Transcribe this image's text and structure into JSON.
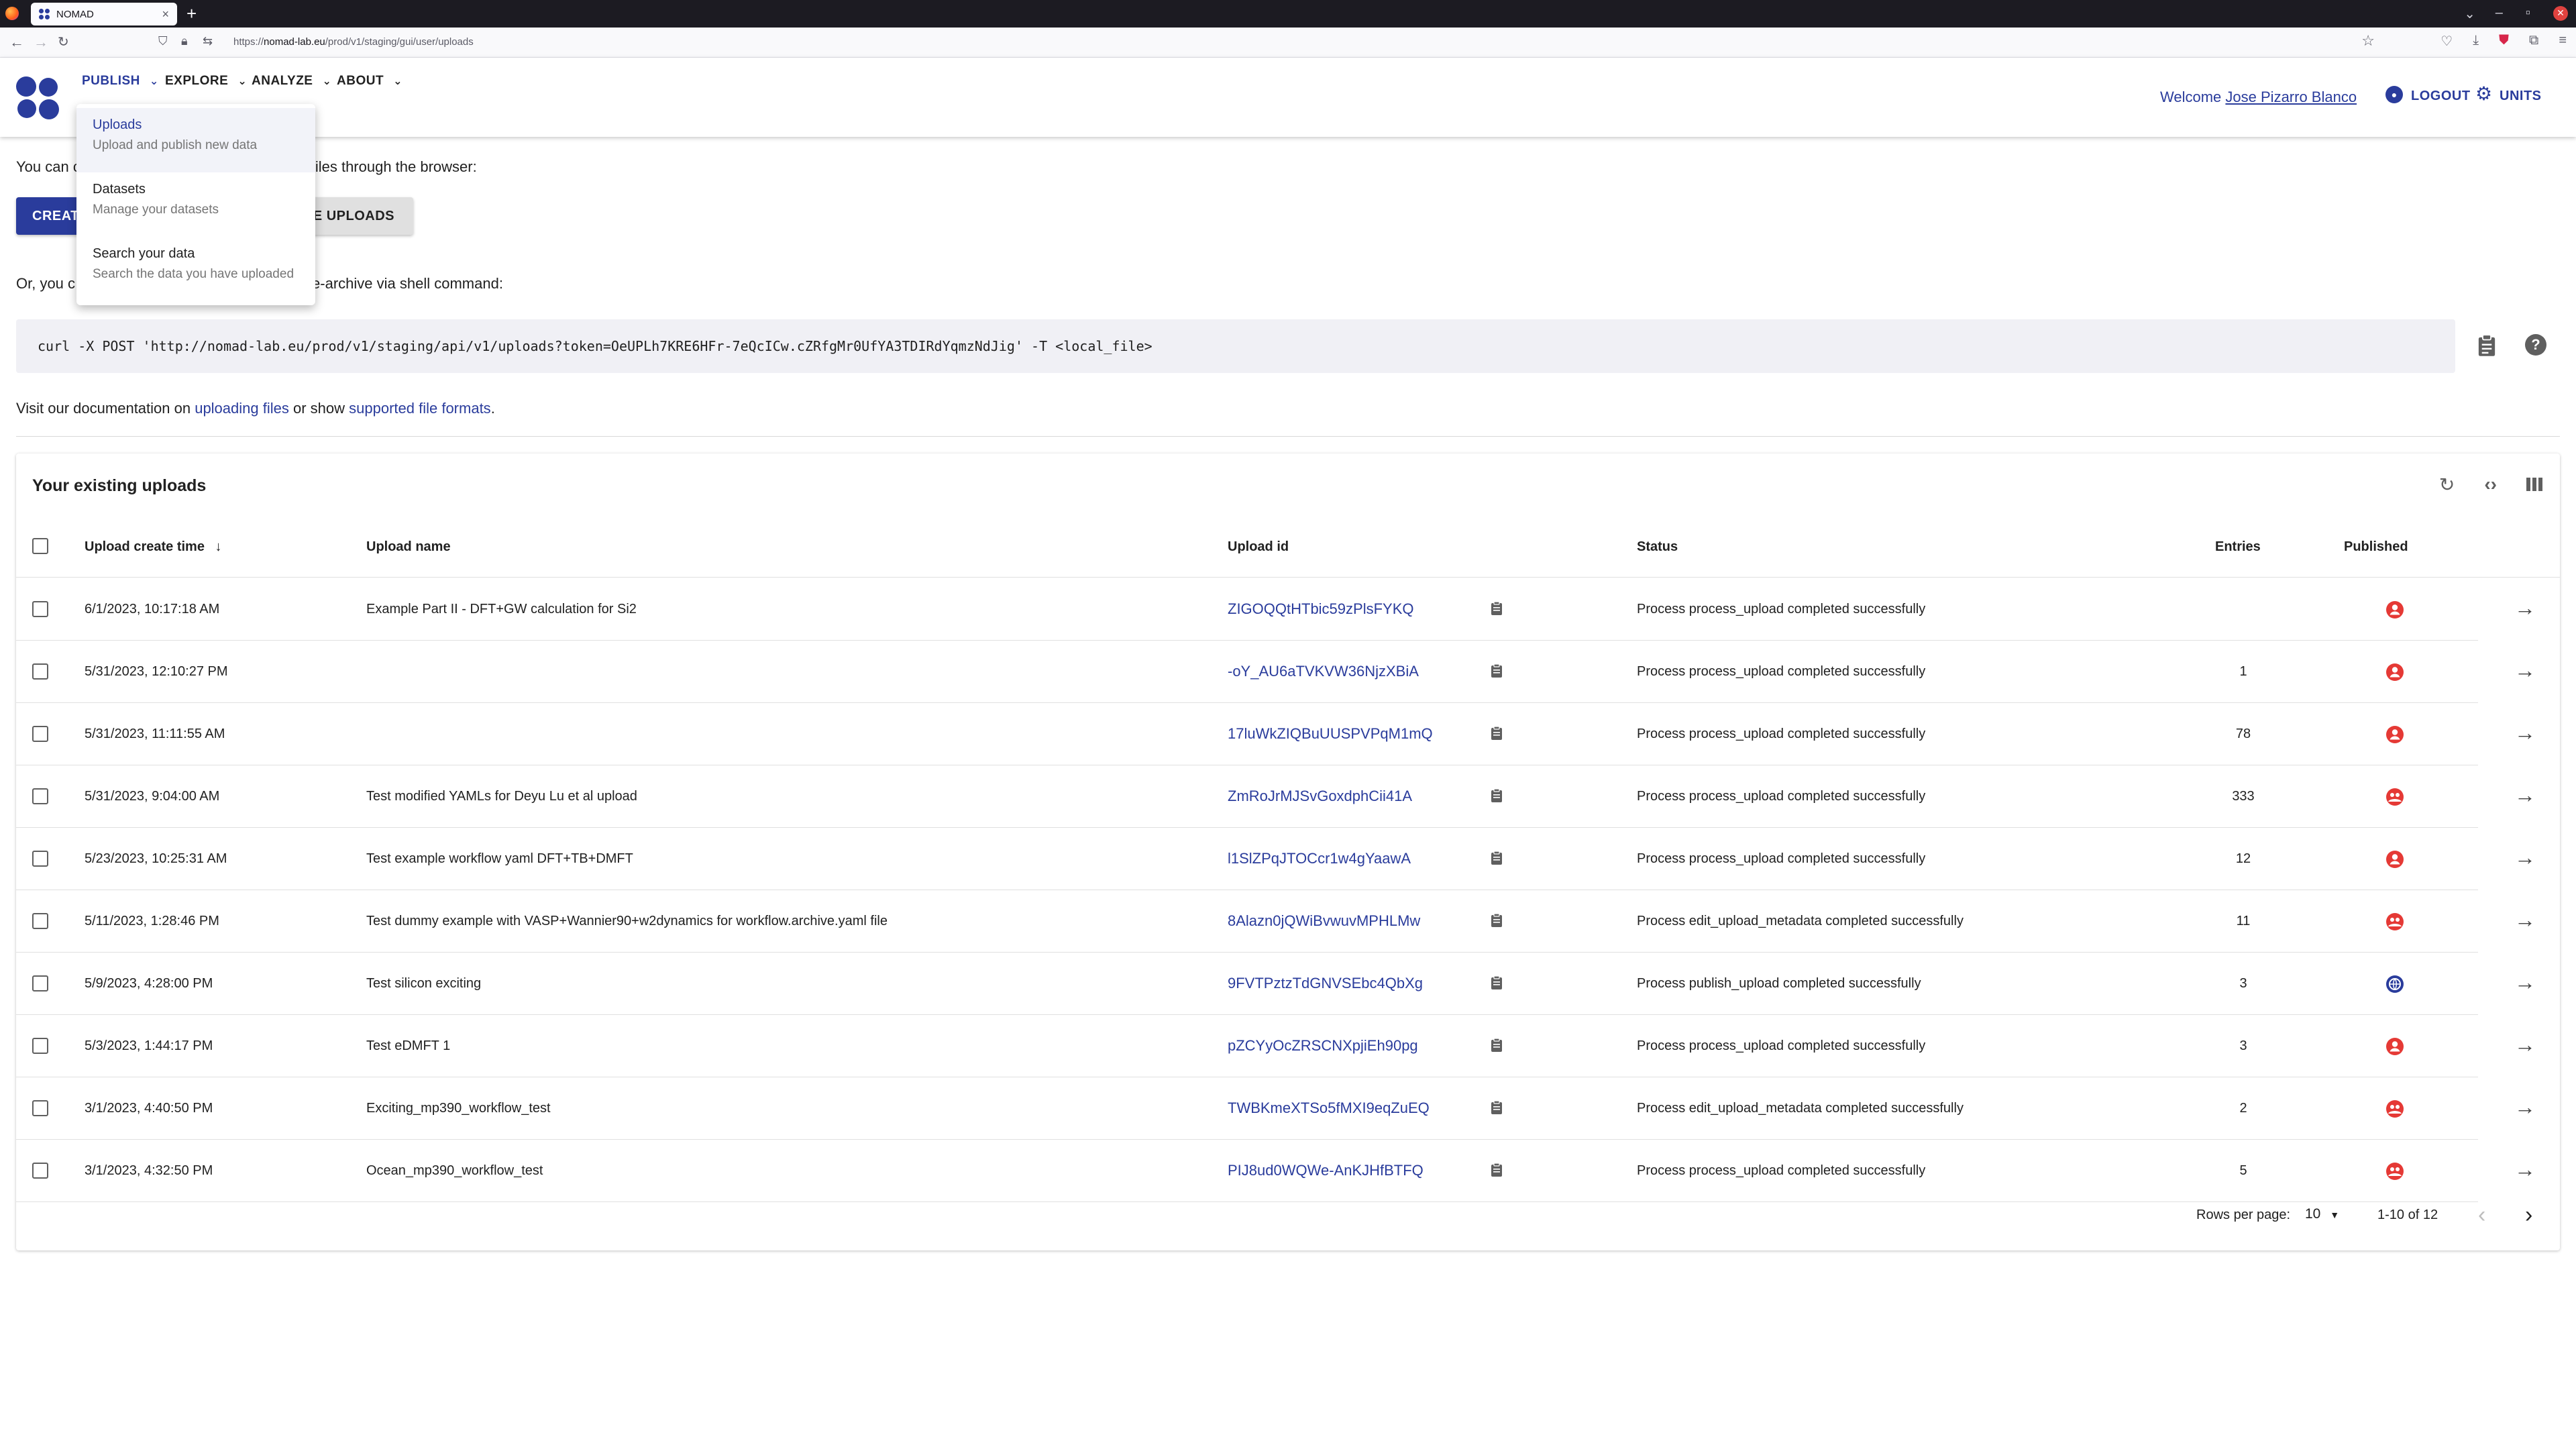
{
  "browser": {
    "tab_title": "NOMAD",
    "url_host": "nomad-lab.eu",
    "url_path": "/prod/v1/staging/gui/user/uploads",
    "url_prefix": "https://"
  },
  "appbar": {
    "menu": [
      {
        "label": "PUBLISH"
      },
      {
        "label": "EXPLORE"
      },
      {
        "label": "ANALYZE"
      },
      {
        "label": "ABOUT"
      }
    ],
    "welcome_prefix": "Welcome",
    "user_name": "Jose Pizarro Blanco",
    "logout_label": "LOGOUT",
    "units_label": "UNITS"
  },
  "dropdown": {
    "items": [
      {
        "title": "Uploads",
        "desc": "Upload and publish new data"
      },
      {
        "title": "Datasets",
        "desc": "Manage your datasets"
      },
      {
        "title": "Search your data",
        "desc": "Search the data you have uploaded"
      }
    ]
  },
  "content": {
    "intro_start": "You can c",
    "intro_end": "iles through the browser:",
    "create_label": "CREATE",
    "example_label": "PLE UPLOADS",
    "or_start": "Or, you c",
    "or_end": "e-archive via shell command:",
    "command": "curl -X POST 'http://nomad-lab.eu/prod/v1/staging/api/v1/uploads?token=OeUPLh7KRE6HFr-7eQcICw.cZRfgMr0UfYA3TDIRdYqmzNdJig' -T <local_file>",
    "doc_prefix": "Visit our documentation on ",
    "doc_link1": "uploading files",
    "doc_mid": " or show ",
    "doc_link2": "supported file formats",
    "doc_suffix": "."
  },
  "uploads": {
    "title": "Your existing uploads",
    "columns": {
      "time": "Upload create time",
      "name": "Upload name",
      "id": "Upload id",
      "status": "Status",
      "entries": "Entries",
      "published": "Published"
    },
    "rows": [
      {
        "time": "6/1/2023, 10:17:18 AM",
        "name": "Example Part II - DFT+GW calculation for Si2",
        "id": "ZIGOQQtHTbic59zPlsFYKQ",
        "status": "Process process_upload completed successfully",
        "entries": "",
        "published": "private"
      },
      {
        "time": "5/31/2023, 12:10:27 PM",
        "name": "",
        "id": "-oY_AU6aTVKVW36NjzXBiA",
        "status": "Process process_upload completed successfully",
        "entries": "1",
        "published": "private"
      },
      {
        "time": "5/31/2023, 11:11:55 AM",
        "name": "",
        "id": "17luWkZIQBuUUSPVPqM1mQ",
        "status": "Process process_upload completed successfully",
        "entries": "78",
        "published": "private"
      },
      {
        "time": "5/31/2023, 9:04:00 AM",
        "name": "Test modified YAMLs for Deyu Lu et al upload",
        "id": "ZmRoJrMJSvGoxdphCii41A",
        "status": "Process process_upload completed successfully",
        "entries": "333",
        "published": "shared"
      },
      {
        "time": "5/23/2023, 10:25:31 AM",
        "name": "Test example workflow yaml DFT+TB+DMFT",
        "id": "l1SlZPqJTOCcr1w4gYaawA",
        "status": "Process process_upload completed successfully",
        "entries": "12",
        "published": "private"
      },
      {
        "time": "5/11/2023, 1:28:46 PM",
        "name": "Test dummy example with VASP+Wannier90+w2dynamics for workflow.archive.yaml file",
        "id": "8Alazn0jQWiBvwuvMPHLMw",
        "status": "Process edit_upload_metadata completed successfully",
        "entries": "11",
        "published": "shared"
      },
      {
        "time": "5/9/2023, 4:28:00 PM",
        "name": "Test silicon exciting",
        "id": "9FVTPztzTdGNVSEbc4QbXg",
        "status": "Process publish_upload completed successfully",
        "entries": "3",
        "published": "public"
      },
      {
        "time": "5/3/2023, 1:44:17 PM",
        "name": "Test eDMFT 1",
        "id": "pZCYyOcZRSCNXpjiEh90pg",
        "status": "Process process_upload completed successfully",
        "entries": "3",
        "published": "private"
      },
      {
        "time": "3/1/2023, 4:40:50 PM",
        "name": "Exciting_mp390_workflow_test",
        "id": "TWBKmeXTSo5fMXI9eqZuEQ",
        "status": "Process edit_upload_metadata completed successfully",
        "entries": "2",
        "published": "shared"
      },
      {
        "time": "3/1/2023, 4:32:50 PM",
        "name": "Ocean_mp390_workflow_test",
        "id": "PIJ8ud0WQWe-AnKJHfBTFQ",
        "status": "Process process_upload completed successfully",
        "entries": "5",
        "published": "shared"
      }
    ],
    "rows_per_page_label": "Rows per page:",
    "rows_per_page": "10",
    "range": "1-10 of 12"
  },
  "colors": {
    "primary": "#2a3c9c",
    "private": "#e53935",
    "public": "#2a3c9c"
  }
}
